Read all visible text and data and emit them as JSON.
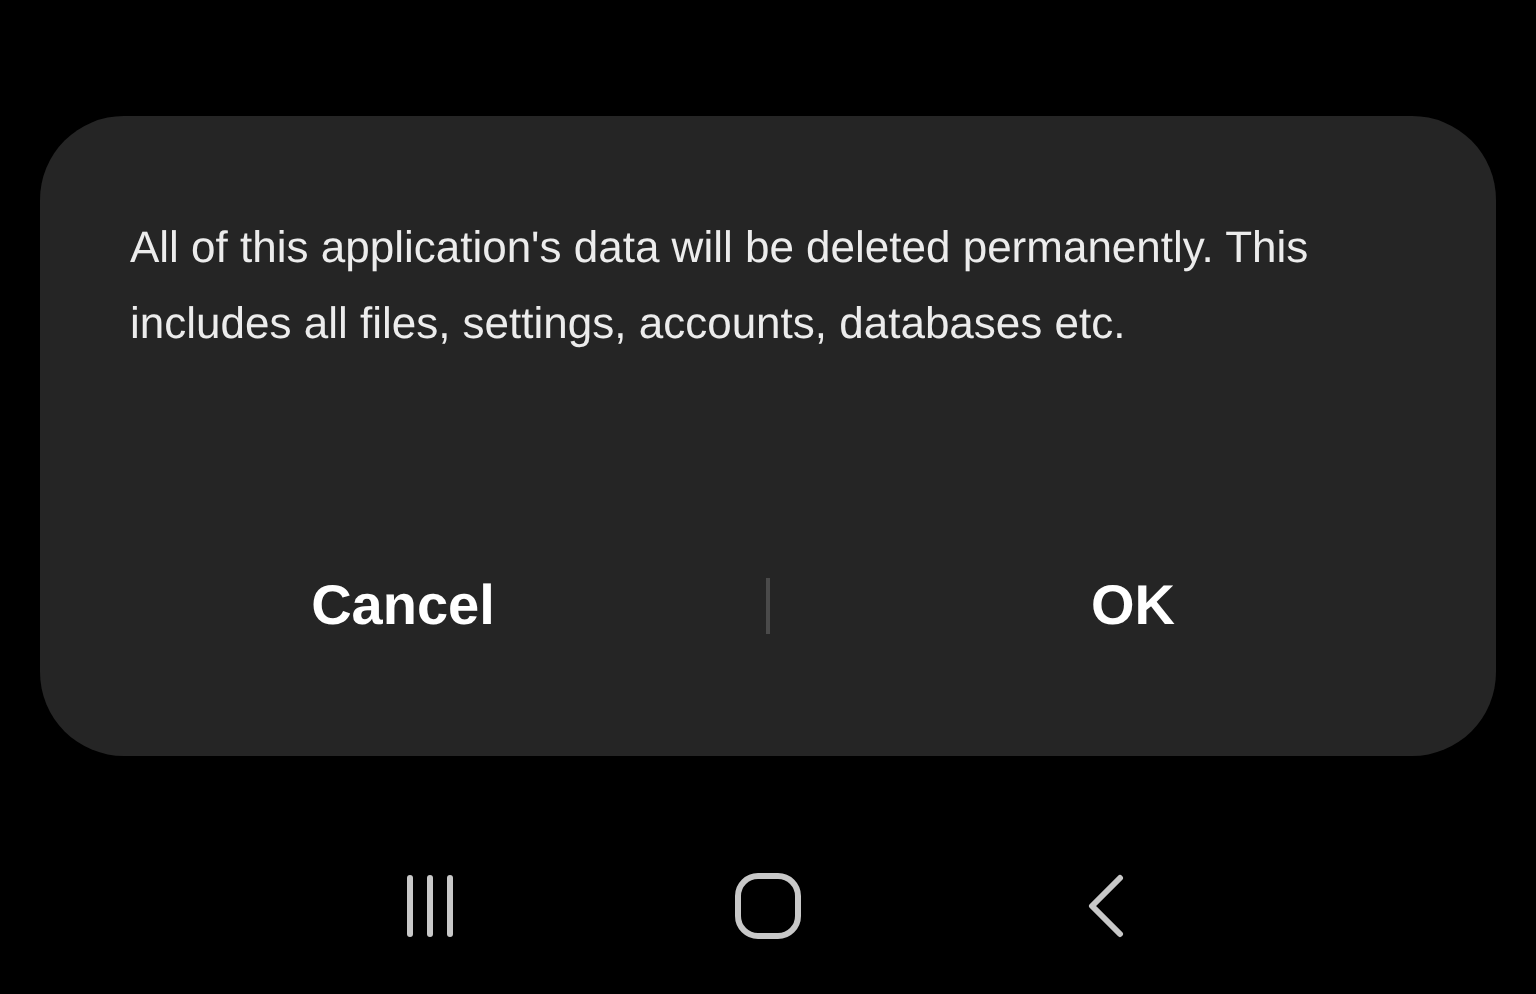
{
  "dialog": {
    "message": "All of this application's data will be deleted permanently. This includes all files, settings, accounts, databases etc.",
    "buttons": [
      {
        "label": "Cancel"
      },
      {
        "label": "OK"
      }
    ]
  },
  "navigation_bar": {
    "buttons": [
      {
        "kind": "recents"
      },
      {
        "kind": "home"
      },
      {
        "kind": "back"
      }
    ]
  }
}
